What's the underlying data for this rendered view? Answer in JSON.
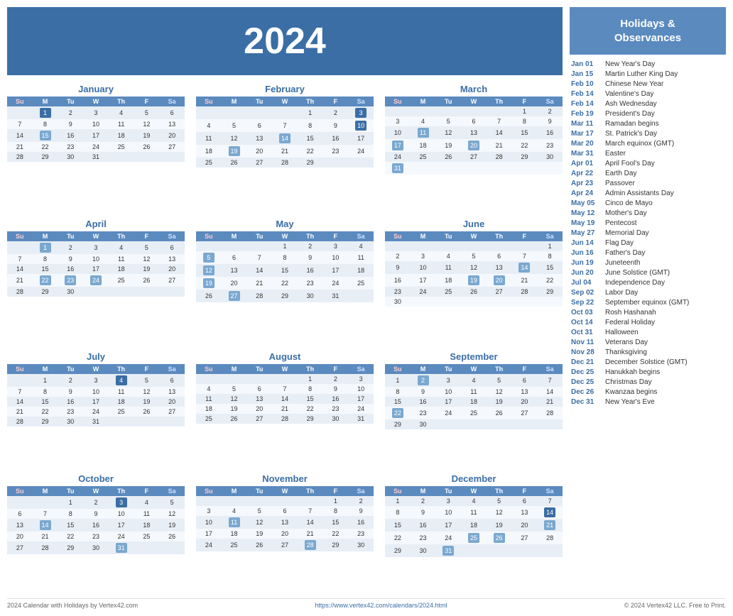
{
  "year": "2024",
  "header": {
    "title": "2024"
  },
  "footer": {
    "left": "2024 Calendar with Holidays by Vertex42.com",
    "center": "https://www.vertex42.com/calendars/2024.html",
    "right": "© 2024 Vertex42 LLC. Free to Print."
  },
  "sidebar": {
    "title": "Holidays &\nObservances",
    "holidays": [
      {
        "date": "Jan 01",
        "name": "New Year's Day"
      },
      {
        "date": "Jan 15",
        "name": "Martin Luther King Day"
      },
      {
        "date": "Feb 10",
        "name": "Chinese New Year"
      },
      {
        "date": "Feb 14",
        "name": "Valentine's Day"
      },
      {
        "date": "Feb 14",
        "name": "Ash Wednesday"
      },
      {
        "date": "Feb 19",
        "name": "President's Day"
      },
      {
        "date": "Mar 11",
        "name": "Ramadan begins"
      },
      {
        "date": "Mar 17",
        "name": "St. Patrick's Day"
      },
      {
        "date": "Mar 20",
        "name": "March equinox (GMT)"
      },
      {
        "date": "Mar 31",
        "name": "Easter"
      },
      {
        "date": "Apr 01",
        "name": "April Fool's Day"
      },
      {
        "date": "Apr 22",
        "name": "Earth Day"
      },
      {
        "date": "Apr 23",
        "name": "Passover"
      },
      {
        "date": "Apr 24",
        "name": "Admin Assistants Day"
      },
      {
        "date": "May 05",
        "name": "Cinco de Mayo"
      },
      {
        "date": "May 12",
        "name": "Mother's Day"
      },
      {
        "date": "May 19",
        "name": "Pentecost"
      },
      {
        "date": "May 27",
        "name": "Memorial Day"
      },
      {
        "date": "Jun 14",
        "name": "Flag Day"
      },
      {
        "date": "Jun 16",
        "name": "Father's Day"
      },
      {
        "date": "Jun 19",
        "name": "Juneteenth"
      },
      {
        "date": "Jun 20",
        "name": "June Solstice (GMT)"
      },
      {
        "date": "Jul 04",
        "name": "Independence Day"
      },
      {
        "date": "Sep 02",
        "name": "Labor Day"
      },
      {
        "date": "Sep 22",
        "name": "September equinox (GMT)"
      },
      {
        "date": "Oct 03",
        "name": "Rosh Hashanah"
      },
      {
        "date": "Oct 14",
        "name": "Federal Holiday"
      },
      {
        "date": "Oct 31",
        "name": "Halloween"
      },
      {
        "date": "Nov 11",
        "name": "Veterans Day"
      },
      {
        "date": "Nov 28",
        "name": "Thanksgiving"
      },
      {
        "date": "Dec 21",
        "name": "December Solstice (GMT)"
      },
      {
        "date": "Dec 25",
        "name": "Hanukkah begins"
      },
      {
        "date": "Dec 25",
        "name": "Christmas Day"
      },
      {
        "date": "Dec 26",
        "name": "Kwanzaa begins"
      },
      {
        "date": "Dec 31",
        "name": "New Year's Eve"
      }
    ]
  },
  "months": [
    {
      "name": "January",
      "weeks": [
        [
          null,
          1,
          2,
          3,
          4,
          5,
          6
        ],
        [
          7,
          8,
          9,
          10,
          11,
          12,
          13
        ],
        [
          14,
          15,
          16,
          17,
          18,
          19,
          20
        ],
        [
          21,
          22,
          23,
          24,
          25,
          26,
          27
        ],
        [
          28,
          29,
          30,
          31,
          null,
          null,
          null
        ]
      ],
      "highlights": {
        "blue": [
          1
        ],
        "light": [
          15
        ]
      }
    },
    {
      "name": "February",
      "weeks": [
        [
          null,
          null,
          null,
          null,
          1,
          2,
          3
        ],
        [
          4,
          5,
          6,
          7,
          8,
          9,
          10
        ],
        [
          11,
          12,
          13,
          14,
          15,
          16,
          17
        ],
        [
          18,
          19,
          20,
          21,
          22,
          23,
          24
        ],
        [
          25,
          26,
          27,
          28,
          29,
          null,
          null
        ]
      ],
      "highlights": {
        "blue": [
          3,
          10
        ],
        "light": [
          14,
          19
        ]
      }
    },
    {
      "name": "March",
      "weeks": [
        [
          null,
          null,
          null,
          null,
          null,
          1,
          2
        ],
        [
          3,
          4,
          5,
          6,
          7,
          8,
          9
        ],
        [
          10,
          11,
          12,
          13,
          14,
          15,
          16
        ],
        [
          17,
          18,
          19,
          20,
          21,
          22,
          23
        ],
        [
          24,
          25,
          26,
          27,
          28,
          29,
          30
        ],
        [
          31,
          null,
          null,
          null,
          null,
          null,
          null
        ]
      ],
      "highlights": {
        "blue": [],
        "light": [
          11,
          17,
          20,
          31
        ]
      }
    },
    {
      "name": "April",
      "weeks": [
        [
          null,
          1,
          2,
          3,
          4,
          5,
          6
        ],
        [
          7,
          8,
          9,
          10,
          11,
          12,
          13
        ],
        [
          14,
          15,
          16,
          17,
          18,
          19,
          20
        ],
        [
          21,
          22,
          23,
          24,
          25,
          26,
          27
        ],
        [
          28,
          29,
          30,
          null,
          null,
          null,
          null
        ]
      ],
      "highlights": {
        "blue": [],
        "light": [
          1,
          22,
          23,
          24
        ]
      }
    },
    {
      "name": "May",
      "weeks": [
        [
          null,
          null,
          null,
          1,
          2,
          3,
          4
        ],
        [
          5,
          6,
          7,
          8,
          9,
          10,
          11
        ],
        [
          12,
          13,
          14,
          15,
          16,
          17,
          18
        ],
        [
          19,
          20,
          21,
          22,
          23,
          24,
          25
        ],
        [
          26,
          27,
          28,
          29,
          30,
          31,
          null
        ]
      ],
      "highlights": {
        "blue": [],
        "light": [
          5,
          12,
          19,
          27
        ]
      }
    },
    {
      "name": "June",
      "weeks": [
        [
          null,
          null,
          null,
          null,
          null,
          null,
          1
        ],
        [
          2,
          3,
          4,
          5,
          6,
          7,
          8
        ],
        [
          9,
          10,
          11,
          12,
          13,
          14,
          15
        ],
        [
          16,
          17,
          18,
          19,
          20,
          21,
          22
        ],
        [
          23,
          24,
          25,
          26,
          27,
          28,
          29
        ],
        [
          30,
          null,
          null,
          null,
          null,
          null,
          null
        ]
      ],
      "highlights": {
        "blue": [],
        "light": [
          14,
          19,
          20
        ]
      }
    },
    {
      "name": "July",
      "weeks": [
        [
          null,
          1,
          2,
          3,
          4,
          5,
          6
        ],
        [
          7,
          8,
          9,
          10,
          11,
          12,
          13
        ],
        [
          14,
          15,
          16,
          17,
          18,
          19,
          20
        ],
        [
          21,
          22,
          23,
          24,
          25,
          26,
          27
        ],
        [
          28,
          29,
          30,
          31,
          null,
          null,
          null
        ]
      ],
      "highlights": {
        "blue": [
          4
        ],
        "light": []
      }
    },
    {
      "name": "August",
      "weeks": [
        [
          null,
          null,
          null,
          null,
          1,
          2,
          3
        ],
        [
          4,
          5,
          6,
          7,
          8,
          9,
          10
        ],
        [
          11,
          12,
          13,
          14,
          15,
          16,
          17
        ],
        [
          18,
          19,
          20,
          21,
          22,
          23,
          24
        ],
        [
          25,
          26,
          27,
          28,
          29,
          30,
          31
        ]
      ],
      "highlights": {
        "blue": [],
        "light": []
      }
    },
    {
      "name": "September",
      "weeks": [
        [
          1,
          2,
          3,
          4,
          5,
          6,
          7
        ],
        [
          8,
          9,
          10,
          11,
          12,
          13,
          14
        ],
        [
          15,
          16,
          17,
          18,
          19,
          20,
          21
        ],
        [
          22,
          23,
          24,
          25,
          26,
          27,
          28
        ],
        [
          29,
          30,
          null,
          null,
          null,
          null,
          null
        ]
      ],
      "highlights": {
        "blue": [],
        "light": [
          2,
          22
        ]
      }
    },
    {
      "name": "October",
      "weeks": [
        [
          null,
          null,
          1,
          2,
          3,
          4,
          5
        ],
        [
          6,
          7,
          8,
          9,
          10,
          11,
          12
        ],
        [
          13,
          14,
          15,
          16,
          17,
          18,
          19
        ],
        [
          20,
          21,
          22,
          23,
          24,
          25,
          26
        ],
        [
          27,
          28,
          29,
          30,
          31,
          null,
          null
        ]
      ],
      "highlights": {
        "blue": [
          3
        ],
        "light": [
          14,
          31
        ]
      }
    },
    {
      "name": "November",
      "weeks": [
        [
          null,
          null,
          null,
          null,
          null,
          1,
          2
        ],
        [
          3,
          4,
          5,
          6,
          7,
          8,
          9
        ],
        [
          10,
          11,
          12,
          13,
          14,
          15,
          16
        ],
        [
          17,
          18,
          19,
          20,
          21,
          22,
          23
        ],
        [
          24,
          25,
          26,
          27,
          28,
          29,
          30
        ]
      ],
      "highlights": {
        "blue": [],
        "light": [
          11,
          28
        ]
      }
    },
    {
      "name": "December",
      "weeks": [
        [
          1,
          2,
          3,
          4,
          5,
          6,
          7
        ],
        [
          8,
          9,
          10,
          11,
          12,
          13,
          14
        ],
        [
          15,
          16,
          17,
          18,
          19,
          20,
          21
        ],
        [
          22,
          23,
          24,
          25,
          26,
          27,
          28
        ],
        [
          29,
          30,
          31,
          null,
          null,
          null,
          null
        ]
      ],
      "highlights": {
        "blue": [
          14
        ],
        "light": [
          21,
          25,
          26,
          31
        ]
      }
    }
  ]
}
